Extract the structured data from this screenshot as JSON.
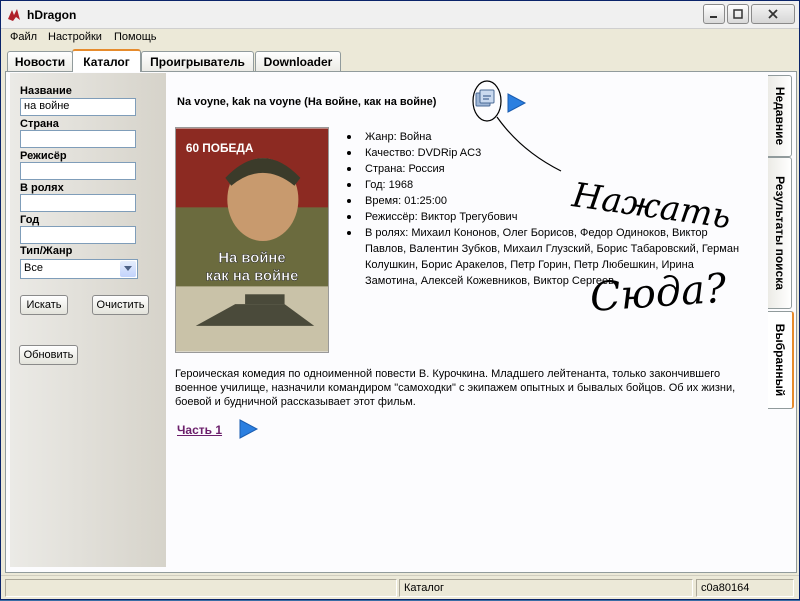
{
  "window": {
    "title": "hDragon"
  },
  "menu": {
    "file": "Файл",
    "settings": "Настройки",
    "help": "Помощь"
  },
  "tabs": [
    {
      "label": "Новости"
    },
    {
      "label": "Каталог"
    },
    {
      "label": "Проигрыватель"
    },
    {
      "label": "Downloader"
    }
  ],
  "search": {
    "title_label": "Название",
    "title_value": "на войне",
    "country_label": "Страна",
    "country_value": "",
    "director_label": "Режисёр",
    "director_value": "",
    "cast_label": "В ролях",
    "cast_value": "",
    "year_label": "Год",
    "year_value": "",
    "genre_label": "Тип/Жанр",
    "genre_value": "Все",
    "search_button": "Искать",
    "clear_button": "Очистить",
    "refresh_button": "Обновить"
  },
  "movie": {
    "title": "Na voyne, kak na voyne (На войне, как на войне)",
    "info": [
      "Жанр: Война",
      "Качество: DVDRip AC3",
      "Страна: Россия",
      "Год: 1968",
      "Время: 01:25:00",
      "Режиссёр: Виктор Трегубович",
      "В ролях: Михаил Кононов, Олег Борисов, Федор Одиноков, Виктор Павлов, Валентин Зубков, Михаил Глузский, Борис Табаровский, Герман Колушкин, Борис Аракелов, Петр Горин, Петр Любешкин, Ирина Замотина, Алексей Кожевников, Виктор Сергеев"
    ],
    "description": "Героическая комедия по одноименной повести В. Курочкина. Младшего лейтенанта, только закончившего военное училище, назначили командиром \"самоходки\" с экипажем опытных и бывалых бойцов. Об их жизни, боевой и будничной рассказывает этот фильм.",
    "part_link": "Часть 1",
    "poster": {
      "top_text": "60 ПОБЕДА",
      "title_line1": "На войне",
      "title_line2": "как на войне"
    }
  },
  "annotation": {
    "line1": "Нажать",
    "line2": "Сюда?"
  },
  "side_tabs": [
    {
      "label": "Недавние"
    },
    {
      "label": "Результаты поиска"
    },
    {
      "label": "Выбранный"
    }
  ],
  "status": {
    "section": "Каталог",
    "id": "c0a80164"
  },
  "colors": {
    "active_tab_accent": "#e68b2c",
    "link": "#6b1f6b",
    "play_blue": "#2b7fe0"
  }
}
